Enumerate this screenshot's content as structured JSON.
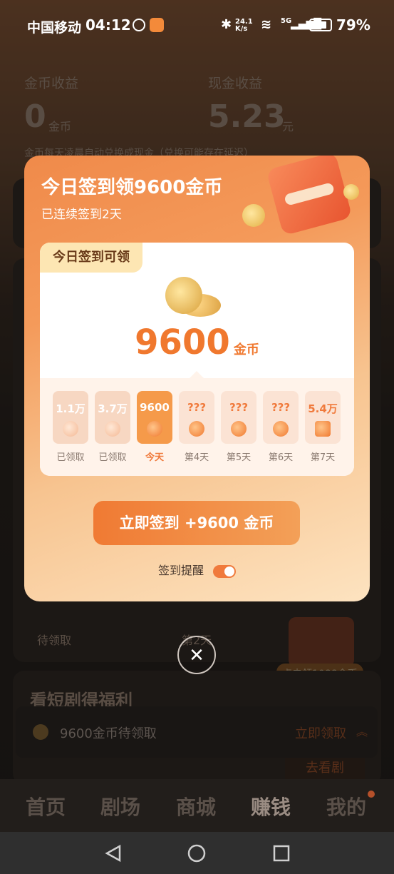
{
  "status_bar": {
    "carrier": "中国移动",
    "time": "04:12",
    "speed": "24.1 K/s",
    "network": "5G",
    "battery": "79%"
  },
  "background": {
    "coin_income_label": "金币收益",
    "coin_value": "0",
    "coin_unit": "金币",
    "cash_income_label": "现金收益",
    "cash_value": "5.23",
    "cash_unit": "元",
    "note": "金币每天凌晨自动兑换成现金（兑换可能存在延迟）",
    "pending_label": "待领取",
    "day2_label": "第2天",
    "chest_claim": "点击领1088金币",
    "section_title": "看短剧得福利",
    "pending_bar": {
      "text": "9600金币待领取",
      "action": "立即领取"
    },
    "go_watch": "去看剧"
  },
  "modal": {
    "title": "今日签到领9600金币",
    "subtitle": "已连续签到2天",
    "tag": "今日签到可领",
    "amount": "9600",
    "amount_unit": "金币",
    "days": [
      {
        "value": "1.1万",
        "label": "已领取",
        "state": "done"
      },
      {
        "value": "3.7万",
        "label": "已领取",
        "state": "done"
      },
      {
        "value": "9600",
        "label": "今天",
        "state": "today"
      },
      {
        "value": "???",
        "label": "第4天",
        "state": "future"
      },
      {
        "value": "???",
        "label": "第5天",
        "state": "future"
      },
      {
        "value": "???",
        "label": "第6天",
        "state": "future"
      },
      {
        "value": "5.4万",
        "label": "第7天",
        "state": "gift"
      }
    ],
    "sign_button": "立即签到 +9600 金币",
    "reminder_label": "签到提醒",
    "reminder_on": true
  },
  "tabs": [
    {
      "label": "首页"
    },
    {
      "label": "剧场"
    },
    {
      "label": "商城"
    },
    {
      "label": "赚钱",
      "active": true
    },
    {
      "label": "我的"
    }
  ],
  "icons": {
    "close": "close-icon",
    "back": "back-icon",
    "home": "home-icon",
    "recents": "recents-icon"
  },
  "colors": {
    "accent": "#f07a3c",
    "modal_top": "#f08a4a",
    "modal_bottom": "#fde3c0"
  }
}
